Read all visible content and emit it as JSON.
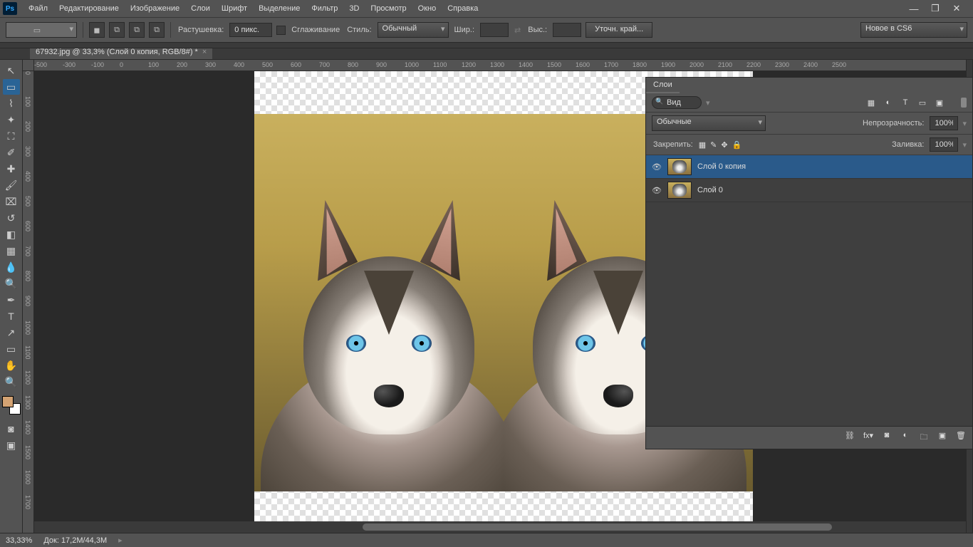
{
  "app_icon": "Ps",
  "menu": [
    "Файл",
    "Редактирование",
    "Изображение",
    "Слои",
    "Шрифт",
    "Выделение",
    "Фильтр",
    "3D",
    "Просмотр",
    "Окно",
    "Справка"
  ],
  "window_buttons": {
    "min": "—",
    "max": "❐",
    "close": "✕"
  },
  "optbar": {
    "feather_label": "Растушевка:",
    "feather_value": "0 пикс.",
    "antialias": "Сглаживание",
    "style_label": "Стиль:",
    "style_value": "Обычный",
    "width_label": "Шир.:",
    "height_label": "Выс.:",
    "refine": "Уточн. край...",
    "news": "Новое в CS6"
  },
  "tab": {
    "title": "67932.jpg @ 33,3% (Слой 0 копия, RGB/8#) *"
  },
  "ruler_h": [
    "-500",
    "-300",
    "-100",
    "0",
    "100",
    "200",
    "300",
    "400",
    "500",
    "600",
    "700",
    "800",
    "900",
    "1000",
    "1100",
    "1200",
    "1300",
    "1400",
    "1500",
    "1600",
    "1700",
    "1800",
    "1900",
    "2000",
    "2100",
    "2200",
    "2300",
    "2400",
    "2500"
  ],
  "ruler_v": [
    "0",
    "100",
    "200",
    "300",
    "400",
    "500",
    "600",
    "700",
    "800",
    "900",
    "1000",
    "1100",
    "1200",
    "1300",
    "1400",
    "1500",
    "1600",
    "1700"
  ],
  "layerspanel": {
    "title": "Слои",
    "search": "Вид",
    "blend": "Обычные",
    "opacity_label": "Непрозрачность:",
    "opacity_value": "100%",
    "lock_label": "Закрепить:",
    "fill_label": "Заливка:",
    "fill_value": "100%",
    "layers": [
      {
        "name": "Слой 0 копия",
        "selected": true
      },
      {
        "name": "Слой 0",
        "selected": false
      }
    ]
  },
  "statusbar": {
    "zoom": "33,33%",
    "doc_label": "Док:",
    "doc_value": "17,2M/44,3M"
  }
}
